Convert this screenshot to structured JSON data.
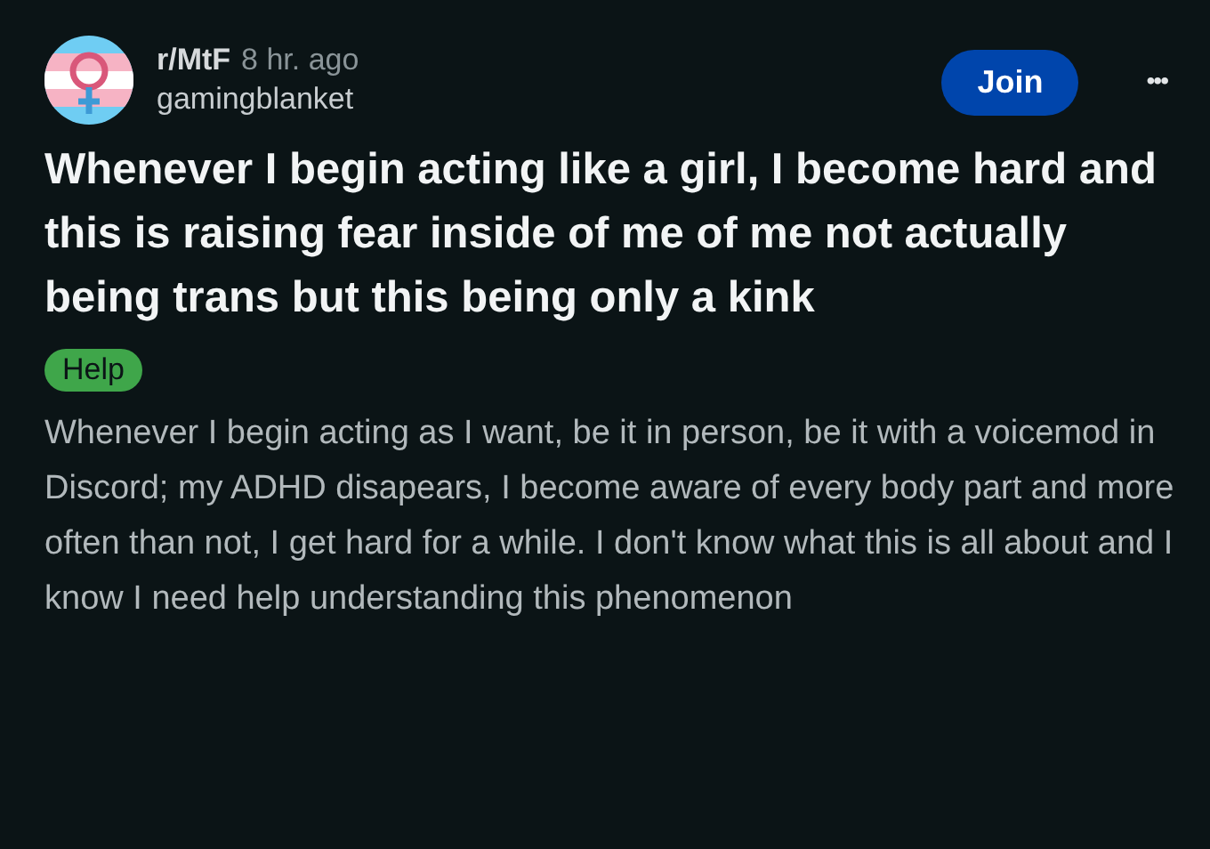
{
  "post": {
    "subreddit": "r/MtF",
    "time": "8 hr. ago",
    "author": "gamingblanket",
    "join_button": "Join",
    "more_button": "•••",
    "title": "Whenever I begin acting like a girl, I become hard and this is raising fear inside of me of me not actually being trans but this being only a kink",
    "flair": {
      "label": "Help",
      "color": "#3fa64a"
    },
    "body": "Whenever I begin acting as I want, be it in person, be it with a voicemod in Discord; my ADHD disapears, I become aware of every body part and more often than not, I get hard for a while. I don't know what this is all about and I know I need help understanding this phenomenon"
  }
}
